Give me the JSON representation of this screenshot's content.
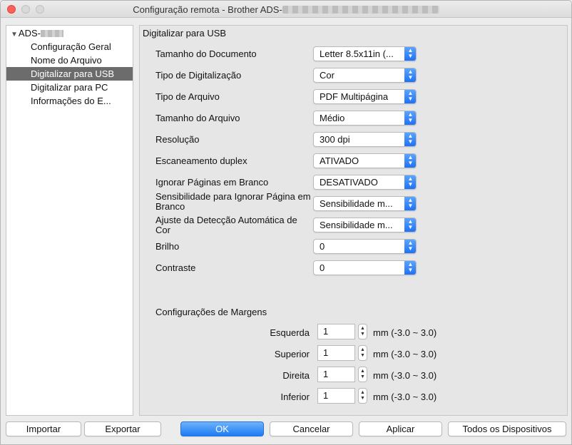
{
  "window": {
    "title_prefix": "Configuração remota - Brother ADS-"
  },
  "sidebar": {
    "root_prefix": "ADS-",
    "items": [
      {
        "label": "Configuração Geral"
      },
      {
        "label": "Nome do Arquivo"
      },
      {
        "label": "Digitalizar para USB"
      },
      {
        "label": "Digitalizar para PC"
      },
      {
        "label": "Informações do E..."
      }
    ],
    "selected_index": 2
  },
  "panel": {
    "title": "Digitalizar para USB",
    "rows": [
      {
        "label": "Tamanho do Documento",
        "value": "Letter 8.5x11in (..."
      },
      {
        "label": "Tipo de Digitalização",
        "value": "Cor"
      },
      {
        "label": "Tipo de Arquivo",
        "value": "PDF Multipágina"
      },
      {
        "label": "Tamanho do Arquivo",
        "value": "Médio"
      },
      {
        "label": "Resolução",
        "value": "300 dpi"
      },
      {
        "label": "Escaneamento duplex",
        "value": "ATIVADO"
      },
      {
        "label": "Ignorar Páginas em Branco",
        "value": "DESATIVADO"
      },
      {
        "label": "Sensibilidade para Ignorar Página em Branco",
        "value": "Sensibilidade m..."
      },
      {
        "label": "Ajuste da Detecção Automática de Cor",
        "value": "Sensibilidade m..."
      },
      {
        "label": "Brilho",
        "value": "0"
      },
      {
        "label": "Contraste",
        "value": "0"
      }
    ],
    "margins": {
      "title": "Configurações de Margens",
      "items": [
        {
          "label": "Esquerda",
          "value": "1",
          "range": "mm (-3.0 ~ 3.0)"
        },
        {
          "label": "Superior",
          "value": "1",
          "range": "mm (-3.0 ~ 3.0)"
        },
        {
          "label": "Direita",
          "value": "1",
          "range": "mm (-3.0 ~ 3.0)"
        },
        {
          "label": "Inferior",
          "value": "1",
          "range": "mm (-3.0 ~ 3.0)"
        }
      ]
    }
  },
  "buttons": {
    "import": "Importar",
    "export": "Exportar",
    "ok": "OK",
    "cancel": "Cancelar",
    "apply": "Aplicar",
    "all_devices": "Todos os Dispositivos"
  },
  "colors": {
    "accent": "#1c7cf4",
    "selection": "#6c6c6c",
    "close": "#fc5f57"
  }
}
